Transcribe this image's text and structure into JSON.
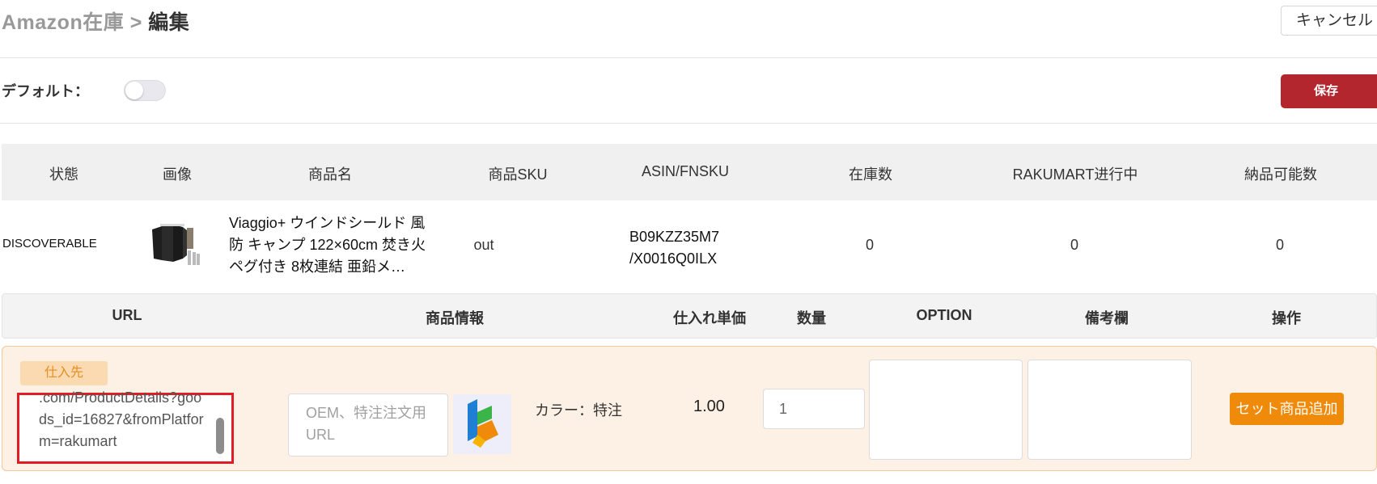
{
  "header": {
    "breadcrumb_parent": "Amazon在庫",
    "breadcrumb_sep": ">",
    "breadcrumb_current": "編集",
    "cancel_label": "キャンセル"
  },
  "settings": {
    "default_label": "デフォルト：",
    "default_on": false,
    "save_label": "保存"
  },
  "inventory_table": {
    "columns": [
      "状態",
      "画像",
      "商品名",
      "商品SKU",
      "ASIN/FNSKU",
      "在庫数",
      "RAKUMART进行中",
      "納品可能数"
    ],
    "row": {
      "status": "DISCOVERABLE",
      "name": "Viaggio+ ウインドシールド 風防 キャンプ 122×60cm 焚き火 ペグ付き 8枚連結 亜鉛メ…",
      "sku": "out",
      "asin_line1": "B09KZZ35M7",
      "asin_line2": "/X0016Q0ILX",
      "stock": "0",
      "rakumart_in_progress": "0",
      "deliverable": "0"
    }
  },
  "supplier_table": {
    "columns": [
      "URL",
      "商品情報",
      "仕入れ単価",
      "数量",
      "OPTION",
      "備考欄",
      "操作"
    ],
    "row": {
      "tag": "仕入先",
      "url_value": ".com/ProductDetails?goods_id=16827&fromPlatform=rakumart",
      "oem_placeholder": "OEM、特注注文用URL",
      "color": "カラー：特注",
      "unit_price": "1.00",
      "quantity": "1",
      "option_value": "",
      "note_value": "",
      "add_set_label": "セット商品追加"
    }
  },
  "colors": {
    "save_red": "#b3262e",
    "accent_orange": "#f08a0a",
    "highlight_red": "#e21c24"
  }
}
